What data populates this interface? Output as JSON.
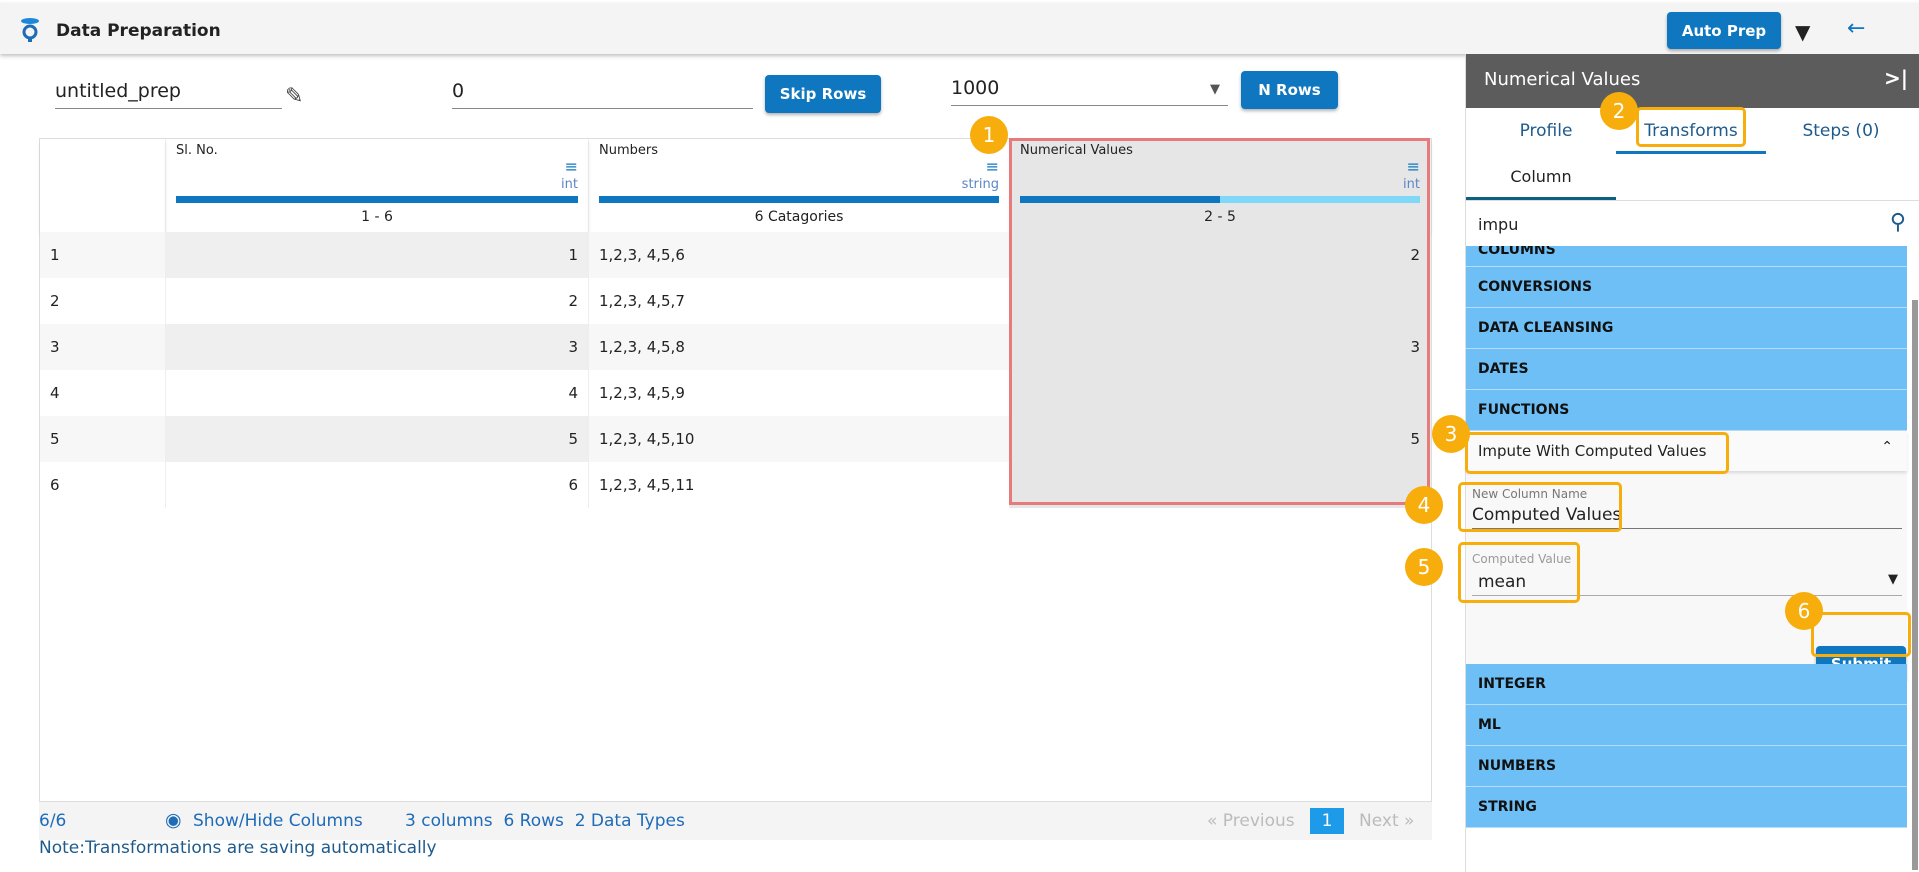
{
  "header": {
    "title": "Data Preparation",
    "auto_prep": "Auto Prep",
    "filter_icon": "filter-icon",
    "back_icon": "arrow-left-icon"
  },
  "toolbar": {
    "prep_name": "untitled_prep",
    "skip_value": "0",
    "skip_label": "Skip Rows",
    "nrows_value": "1000",
    "nrows_label": "N Rows"
  },
  "table": {
    "columns": [
      {
        "name": "Sl. No.",
        "type": "int",
        "range": "1 - 6"
      },
      {
        "name": "Numbers",
        "type": "string",
        "range": "6 Catagories"
      },
      {
        "name": "Numerical Values",
        "type": "int",
        "range": "2 - 5",
        "fill_fraction": 0.5
      }
    ],
    "rows": [
      [
        "1",
        "1",
        "1,2,3, 4,5,6",
        "2"
      ],
      [
        "2",
        "2",
        "1,2,3, 4,5,7",
        ""
      ],
      [
        "3",
        "3",
        "1,2,3, 4,5,8",
        "3"
      ],
      [
        "4",
        "4",
        "1,2,3, 4,5,9",
        ""
      ],
      [
        "5",
        "5",
        "1,2,3, 4,5,10",
        "5"
      ],
      [
        "6",
        "6",
        "1,2,3, 4,5,11",
        ""
      ]
    ]
  },
  "footer": {
    "count": "6/6",
    "show_hide": "Show/Hide Columns",
    "summary": "3 columns  6 Rows  2 Data Types",
    "prev": "« Previous",
    "page": "1",
    "next": "Next »",
    "note": "Note:Transformations are saving automatically"
  },
  "panel": {
    "title": "Numerical Values",
    "collapse_icon": "collapse-right-icon",
    "tabs": [
      "Profile",
      "Transforms",
      "Steps (0)"
    ],
    "subtab": "Column",
    "search": "impu",
    "groups_top": [
      "COLUMNS",
      "CONVERSIONS",
      "DATA CLEANSING",
      "DATES",
      "FUNCTIONS"
    ],
    "expanded": {
      "title": "Impute With Computed Values",
      "new_col_label": "New Column Name",
      "new_col_value": "Computed Values",
      "computed_label": "Computed Value",
      "computed_value": "mean",
      "submit": "Submit"
    },
    "groups_bottom": [
      "INTEGER",
      "ML",
      "NUMBERS",
      "STRING"
    ]
  },
  "badges": [
    "1",
    "2",
    "3",
    "4",
    "5",
    "6"
  ],
  "colors": {
    "primary": "#0f77c0",
    "accordion": "#6dbff6",
    "badge": "#f7ad0c",
    "highlight": "#e77a7a"
  }
}
